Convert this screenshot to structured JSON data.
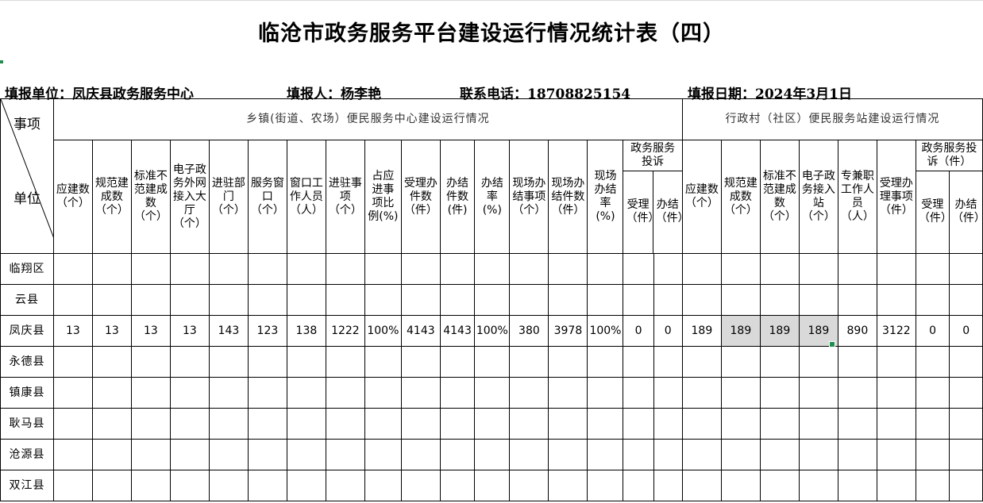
{
  "title": "临沧市政务服务平台建设运行情况统计表（四）",
  "info": {
    "unit": "填报单位：凤庆县政务服务中心",
    "filler": "填报人：杨李艳",
    "phone": "联系电话：18708825154",
    "date": "填报日期：2024年3月1日"
  },
  "corner": {
    "top": "事项",
    "bottom": "单位"
  },
  "sections": {
    "township": "乡镇(街道、农场）便民服务中心建设运行情况",
    "village": "行政村（社区）便民服务站建设运行情况"
  },
  "columns": {
    "c1": "应建数（个）",
    "c2": "规范建成数（个）",
    "c3": "标准不范建成数（个）",
    "c4": "电子政务外网接入大厅（个）",
    "c5": "进驻部门（个）",
    "c6": "服务窗口（个）",
    "c7": "窗口工作人员（人）",
    "c8": "进驻事项（个）",
    "c9": "占应进事项比例(%)",
    "c10": "受理办件数（件）",
    "c11": "办结件数(件)",
    "c12": "办结率(%)",
    "c13": "现场办结事项（个）",
    "c14": "现场办结件数（件）",
    "c15": "现场办结率(%)",
    "complaint_group": "政务服务投诉",
    "c16": "受理（件）",
    "c17": "办结（件）",
    "v1": "应建数（个）",
    "v2": "规范建成数（个）",
    "v3": "标准不范建成数（个）",
    "v4": "电子政务接入站（个）",
    "v5": "专兼职工作人员（人）",
    "v6": "受理办理事项（件）",
    "v_complaint_group": "政务服务投诉（件）",
    "v7": "受理（件）",
    "v8": "办结（件）"
  },
  "rows": [
    {
      "name": "临翔区"
    },
    {
      "name": "云县"
    },
    {
      "name": "凤庆县",
      "c1": "13",
      "c2": "13",
      "c3": "13",
      "c4": "13",
      "c5": "143",
      "c6": "123",
      "c7": "138",
      "c8": "1222",
      "c9": "100%",
      "c10": "4143",
      "c11": "4143",
      "c12": "100%",
      "c13": "380",
      "c14": "3978",
      "c15": "100%",
      "c16": "0",
      "c17": "0",
      "v1": "189",
      "v2": "189",
      "v3": "189",
      "v4": "189",
      "v5": "890",
      "v6": "3122",
      "v7": "0",
      "v8": "0"
    },
    {
      "name": "永德县"
    },
    {
      "name": "镇康县"
    },
    {
      "name": "耿马县"
    },
    {
      "name": "沧源县"
    },
    {
      "name": "双江县"
    }
  ]
}
